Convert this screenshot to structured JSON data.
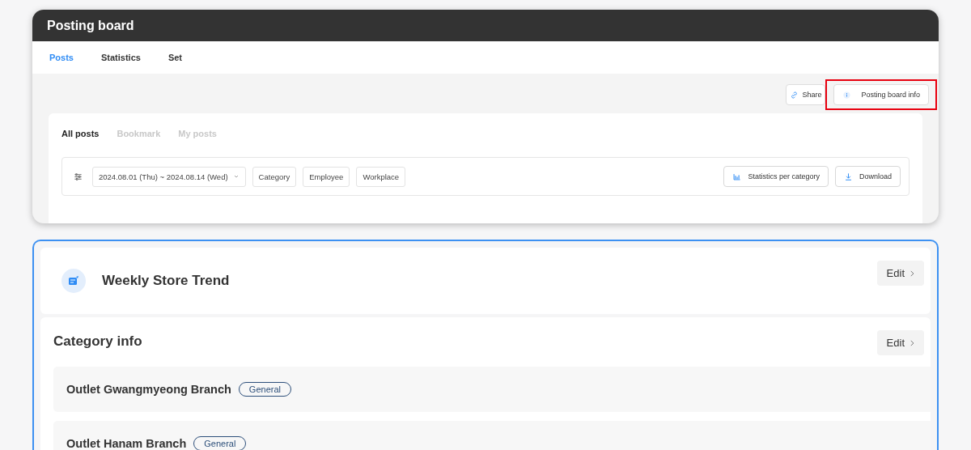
{
  "window": {
    "title": "Posting board"
  },
  "tabs": [
    {
      "label": "Posts",
      "selected": true
    },
    {
      "label": "Statistics",
      "selected": false
    },
    {
      "label": "Set",
      "selected": false
    }
  ],
  "actions": [
    {
      "kind": "link",
      "label": "Share",
      "highlighted": false
    },
    {
      "kind": "info",
      "label": "Posting board info",
      "highlighted": true
    }
  ],
  "sub_tabs": [
    {
      "label": "All posts",
      "selected": true
    },
    {
      "label": "Bookmark",
      "selected": false
    },
    {
      "label": "My posts",
      "selected": false
    }
  ],
  "filters": {
    "date_range": "2024.08.01 (Thu) ~ 2024.08.14 (Wed)",
    "chips": [
      "Category",
      "Employee",
      "Workplace"
    ]
  },
  "tools": [
    {
      "kind": "chart",
      "label": "Statistics per category"
    },
    {
      "kind": "download",
      "label": "Download"
    }
  ],
  "board": {
    "title": "Weekly Store Trend",
    "edit": "Edit"
  },
  "category_info": {
    "title": "Category info",
    "edit": "Edit",
    "items": [
      {
        "name": "Outlet Gwangmyeong Branch",
        "tag": "General"
      },
      {
        "name": "Outlet Hanam Branch",
        "tag": "General"
      }
    ]
  }
}
